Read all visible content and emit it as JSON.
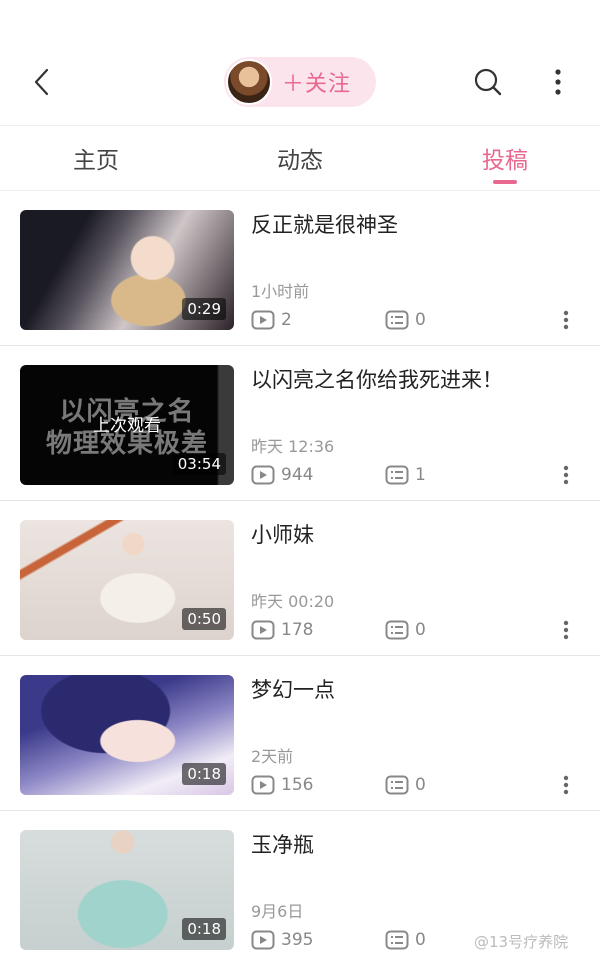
{
  "header": {
    "follow_label": "＋关注",
    "icons": [
      "back-icon",
      "search-icon",
      "more-vertical-icon"
    ],
    "accent_color": "#e9688f"
  },
  "tabs": [
    {
      "label": "主页",
      "active": false
    },
    {
      "label": "动态",
      "active": false
    },
    {
      "label": "投稿",
      "active": true
    }
  ],
  "videos": [
    {
      "title": "反正就是很神圣",
      "time": "1小时前",
      "duration": "0:29",
      "plays": "2",
      "comments": "0"
    },
    {
      "title": "以闪亮之名你给我死进来！",
      "time": "昨天 12:36",
      "duration": "03:54",
      "plays": "944",
      "comments": "1",
      "watched_tag": "上次观看",
      "overlay_line1": "以闪亮之名",
      "overlay_line2": "物理效果极差"
    },
    {
      "title": "小师妹",
      "time": "昨天 00:20",
      "duration": "0:50",
      "plays": "178",
      "comments": "0"
    },
    {
      "title": "梦幻一点",
      "time": "2天前",
      "duration": "0:18",
      "plays": "156",
      "comments": "0"
    },
    {
      "title": "玉净瓶",
      "time": "9月6日",
      "duration": "0:18",
      "plays": "395",
      "comments": "0"
    }
  ],
  "watermark": "@13号疗养院"
}
